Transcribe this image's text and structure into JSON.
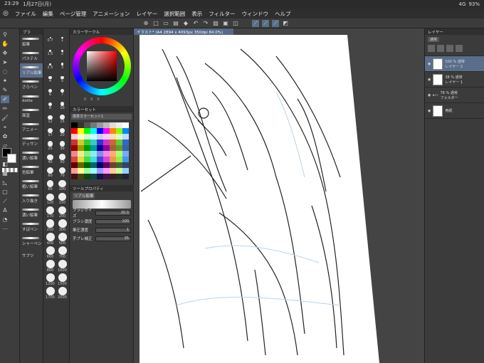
{
  "status": {
    "time": "23:29",
    "date": "1月27日(月)",
    "signal": "4G",
    "battery": "93%"
  },
  "menu": [
    "ファイル",
    "編集",
    "ページ管理",
    "アニメーション",
    "レイヤー",
    "選択範囲",
    "表示",
    "フィルター",
    "ウィンドウ",
    "ヘルプ"
  ],
  "subtool": {
    "tab_label": "ブラ",
    "items": [
      "鉛筆",
      "パステル",
      "リアル鉛筆",
      "さらペン",
      "dollie",
      "面塗",
      "アニメー",
      "デッサン",
      "濃い鉛筆",
      "色鉛筆",
      "粗い鉛筆",
      "入り抜き",
      "濃い鉛筆",
      "すばペン",
      "シャーペン",
      "サブツ"
    ]
  },
  "brush_sizes": [
    "0.7",
    "1",
    "1.5",
    "2",
    "2.5",
    "3",
    "4",
    "5",
    "6",
    "7",
    "8",
    "10",
    "12",
    "15",
    "17",
    "20",
    "25",
    "30",
    "40",
    "50",
    "60",
    "70",
    "80",
    "100",
    "120",
    "150",
    "170",
    "200",
    "250",
    "300",
    "400",
    "500",
    "600",
    "700",
    "800",
    "1000",
    "1200",
    "1500",
    "1700",
    "2000"
  ],
  "color_wheel": {
    "title": "カラーサークル",
    "hsv": [
      "0",
      "0",
      "0"
    ]
  },
  "color_set": {
    "title": "カラーセット",
    "set_name": "標準カラーセット1"
  },
  "tool_property": {
    "title": "ツールプロパティ",
    "brush_name": "リアル鉛筆",
    "brush_size_label": "ブラシサイズ",
    "brush_size": "20.0",
    "density_label": "ブラシ濃度",
    "density": "100",
    "pressure_label": "筆圧濃度",
    "pressure": "1",
    "stabilize_label": "手ブレ補正",
    "stabilize": "35"
  },
  "document": {
    "tab_label": "イラスト* (A4 2894 x 4093px 350dpi 84.0%)"
  },
  "layers": {
    "title": "レイヤー",
    "blend_mode": "通常",
    "items": [
      {
        "opacity": "100 % 通常",
        "name": "レイヤー 2"
      },
      {
        "opacity": "38 % 通常",
        "name": "レイヤー 1"
      },
      {
        "opacity": "76 % 通常",
        "name": "フォルダー"
      },
      {
        "opacity": "",
        "name": "用紙"
      }
    ]
  },
  "colors": {
    "accent": "#5a6e8a",
    "panel": "#3b3b3b",
    "canvas": "#ffffff"
  }
}
